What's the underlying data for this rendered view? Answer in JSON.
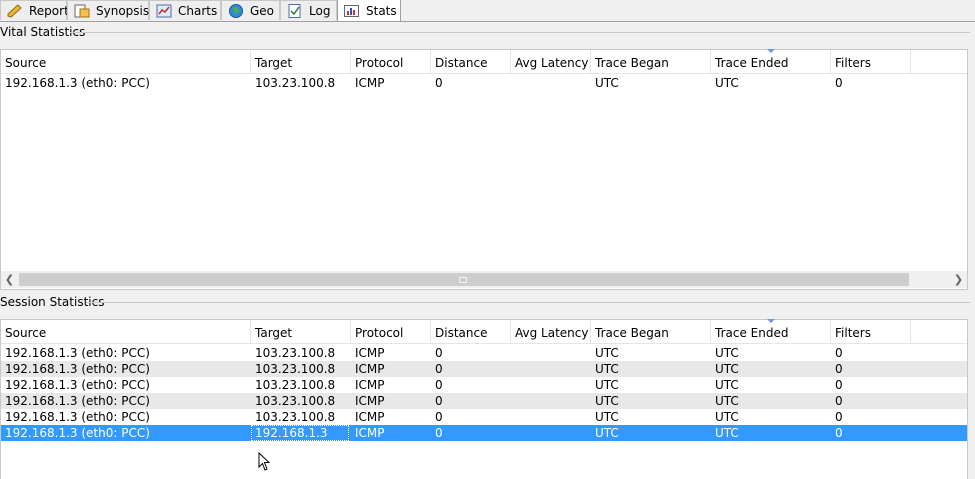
{
  "tabs": [
    {
      "label": "Report",
      "icon": "pencil-icon"
    },
    {
      "label": "Synopsis",
      "icon": "synopsis-icon"
    },
    {
      "label": "Charts",
      "icon": "chart-icon"
    },
    {
      "label": "Geo",
      "icon": "globe-icon"
    },
    {
      "label": "Log",
      "icon": "log-icon"
    },
    {
      "label": "Stats",
      "icon": "stats-icon",
      "active": true
    }
  ],
  "columns": [
    "Source",
    "Target",
    "Protocol",
    "Distance",
    "Avg Latency",
    "Trace Began",
    "Trace Ended",
    "Filters"
  ],
  "vital": {
    "title": "Vital Statistics",
    "rows": [
      [
        "192.168.1.3 (eth0: PCC)",
        "103.23.100.8",
        "ICMP",
        "0",
        "",
        "UTC",
        "UTC",
        "0"
      ]
    ]
  },
  "session": {
    "title": "Session Statistics",
    "rows": [
      [
        "192.168.1.3 (eth0: PCC)",
        "103.23.100.8",
        "ICMP",
        "0",
        "",
        "UTC",
        "UTC",
        "0"
      ],
      [
        "192.168.1.3 (eth0: PCC)",
        "103.23.100.8",
        "ICMP",
        "0",
        "",
        "UTC",
        "UTC",
        "0"
      ],
      [
        "192.168.1.3 (eth0: PCC)",
        "103.23.100.8",
        "ICMP",
        "0",
        "",
        "UTC",
        "UTC",
        "0"
      ],
      [
        "192.168.1.3 (eth0: PCC)",
        "103.23.100.8",
        "ICMP",
        "0",
        "",
        "UTC",
        "UTC",
        "0"
      ],
      [
        "192.168.1.3 (eth0: PCC)",
        "103.23.100.8",
        "ICMP",
        "0",
        "",
        "UTC",
        "UTC",
        "0"
      ],
      [
        "192.168.1.3 (eth0: PCC)",
        "192.168.1.3",
        "ICMP",
        "0",
        "",
        "UTC",
        "UTC",
        "0"
      ]
    ],
    "selected_row": 5
  },
  "colors": {
    "selection": "#3399ff",
    "alt_row": "#e8e8e8",
    "sort_indicator": "#6b9bd6"
  }
}
